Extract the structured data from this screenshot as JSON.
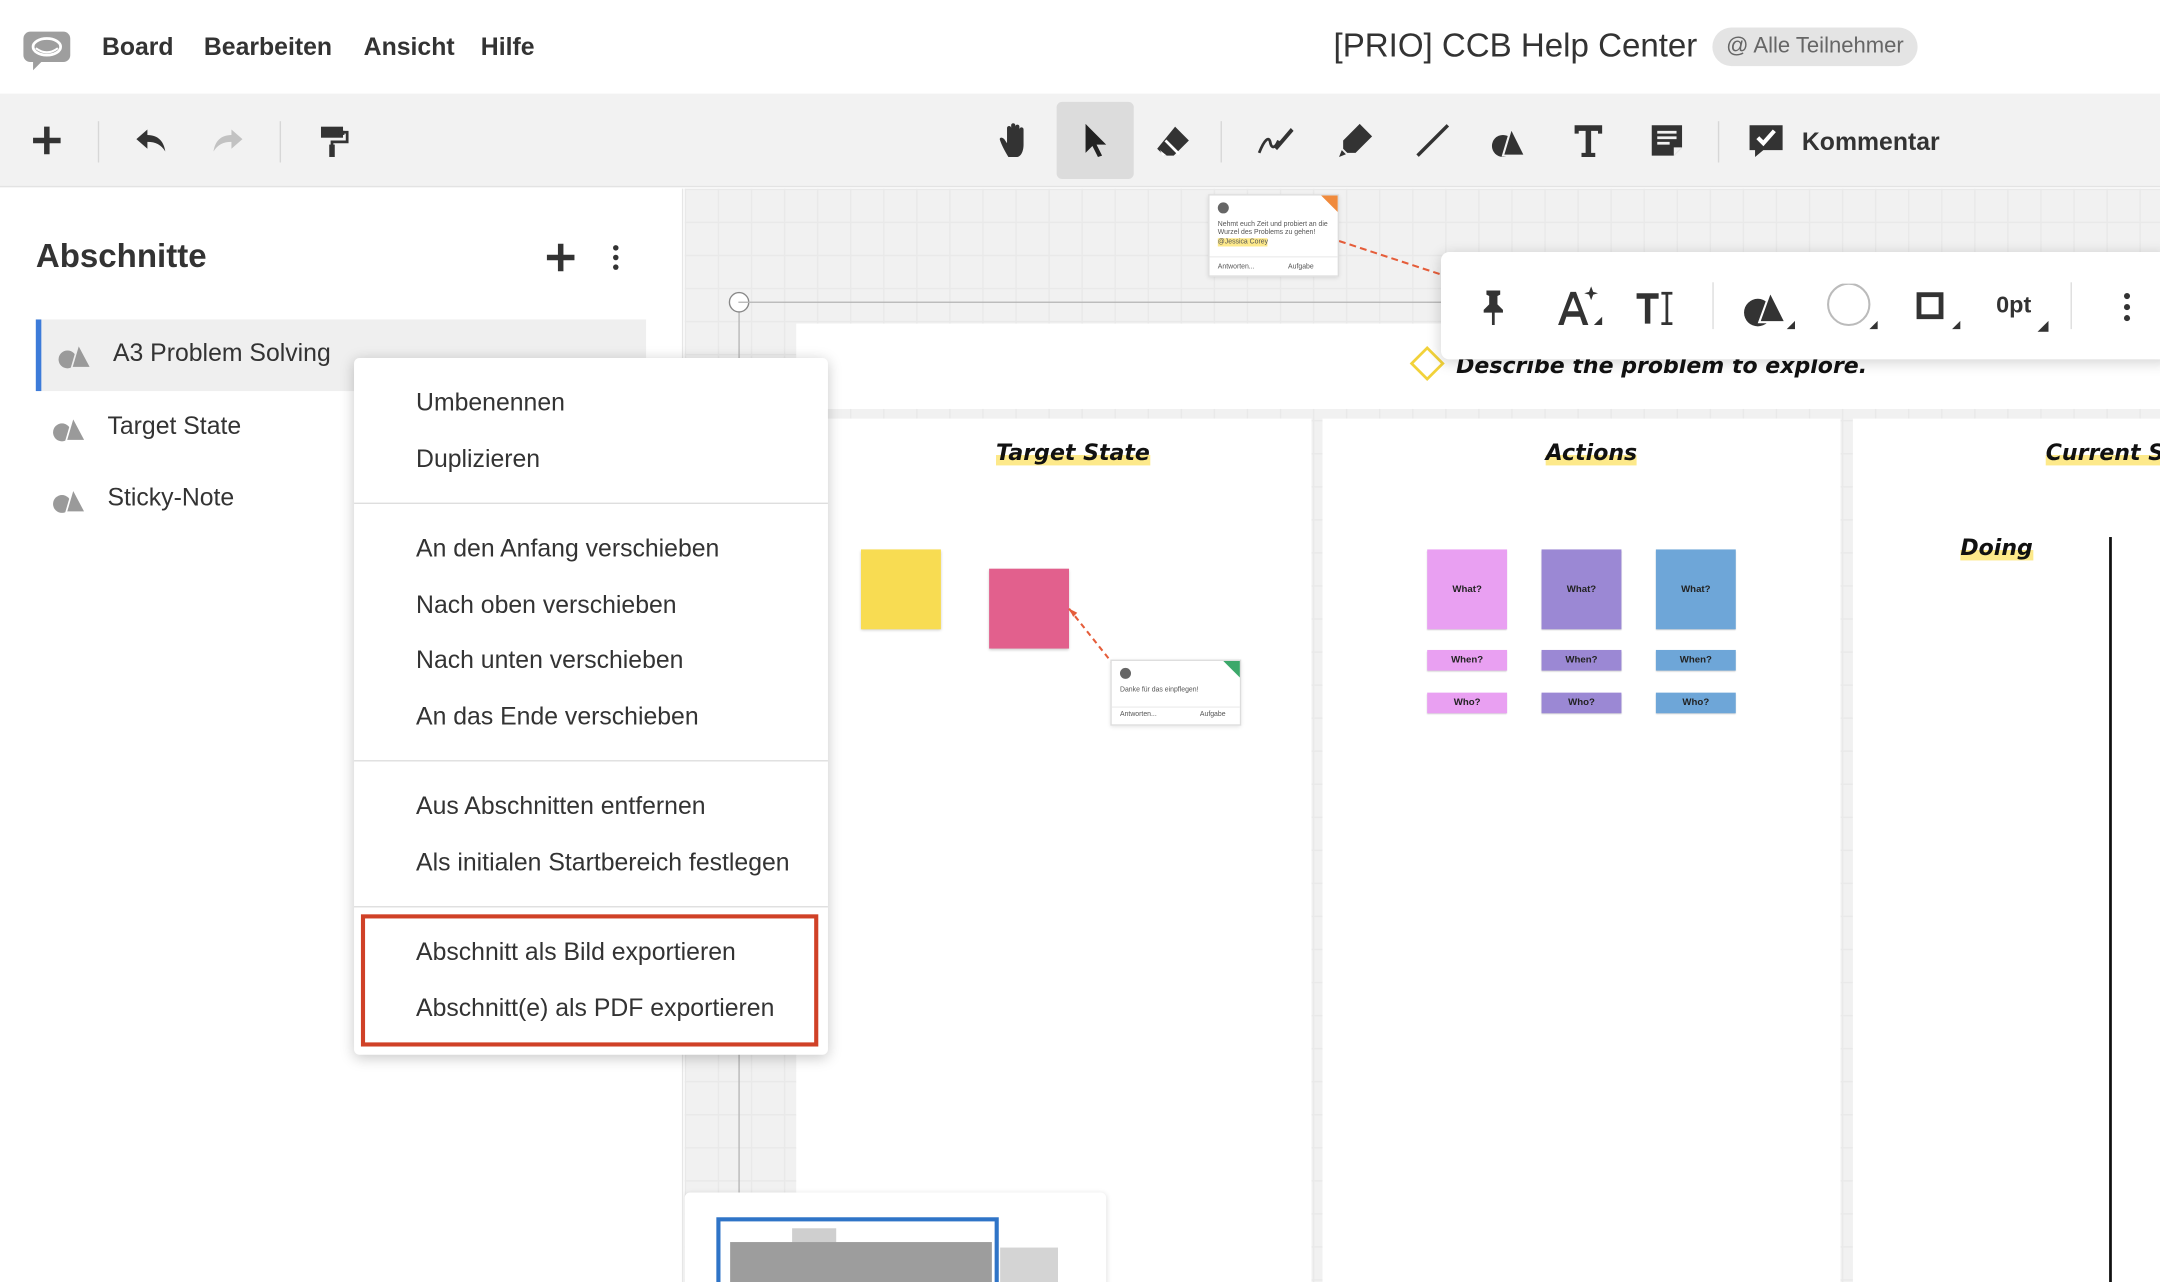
{
  "menubar": {
    "items": [
      "Board",
      "Bearbeiten",
      "Ansicht",
      "Hilfe"
    ],
    "board_title": "[PRIO] CCB Help Center",
    "participants_label": "@ Alle Teilnehmer"
  },
  "toolbar": {
    "comment_label": "Kommentar",
    "tools": [
      "add-icon",
      "undo-icon",
      "redo-icon",
      "format-painter-icon",
      "hand-icon",
      "pointer-icon",
      "eraser-icon",
      "pen-icon",
      "highlighter-icon",
      "line-icon",
      "shapes-icon",
      "text-icon",
      "sticky-note-icon",
      "comment-icon"
    ]
  },
  "sidebar": {
    "title": "Abschnitte",
    "items": [
      {
        "label": "A3 Problem Solving",
        "active": true
      },
      {
        "label": "Target State",
        "active": false
      },
      {
        "label": "Sticky-Note",
        "active": false
      }
    ]
  },
  "context_menu": {
    "groups": [
      [
        "Umbenennen",
        "Duplizieren"
      ],
      [
        "An den Anfang verschieben",
        "Nach oben verschieben",
        "Nach unten verschieben",
        "An das Ende verschieben"
      ],
      [
        "Aus Abschnitten entfernen",
        "Als initialen Startbereich festlegen"
      ],
      [
        "Abschnitt als Bild exportieren",
        "Abschnitt(e) als PDF exportieren"
      ]
    ],
    "highlight_color": "#d04127"
  },
  "floating_toolbar": {
    "stroke_width": "0pt"
  },
  "canvas": {
    "problem_prompt": "Describe the problem to explore.",
    "columns": [
      "Target State",
      "Actions",
      "Current Stat"
    ],
    "doing_label": "Doing",
    "sticky_labels": {
      "what": "What?",
      "when": "When?",
      "who": "Who?"
    },
    "sticky_colors": [
      "#e9a0f2",
      "#9b88d4",
      "#6ea6d8"
    ],
    "comment_top": {
      "text": "Nehmt euch Zeit und probiert an die Wurzel des Problems zu gehen!",
      "mention": "@Jessica Corey",
      "reply": "Antworten...",
      "task": "Aufgabe"
    },
    "comment_mid": {
      "text": "Danke für das einpflegen!",
      "reply": "Antworten...",
      "task": "Aufgabe"
    }
  },
  "colors": {
    "accent_blue": "#3d7bd9",
    "yellow_sticky": "#f8dc52",
    "pink_sticky": "#e2608d"
  }
}
